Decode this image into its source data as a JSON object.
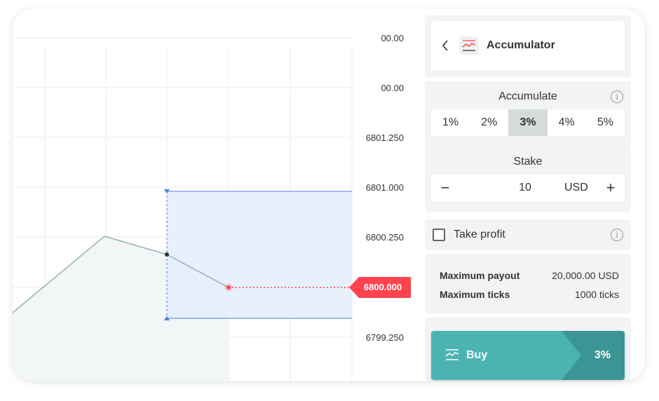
{
  "chart": {
    "price_labels": [
      "00.00",
      "00.00",
      "6801.250",
      "6801.000",
      "6800.250",
      "6800.000",
      "6799.250"
    ],
    "current_price": "6800.000",
    "line_color": "#8fb6b4",
    "barrier_color": "#4a7fe0",
    "current_color": "#ff444f"
  },
  "header": {
    "title": "Accumulator",
    "back_icon": "chevron-left-icon",
    "trade_icon": "accumulator-icon"
  },
  "accumulate": {
    "title": "Accumulate",
    "info_icon": "info-icon",
    "options": [
      "1%",
      "2%",
      "3%",
      "4%",
      "5%"
    ],
    "selected": "3%"
  },
  "stake": {
    "title": "Stake",
    "minus": "−",
    "plus": "+",
    "value": "10",
    "currency": "USD"
  },
  "take_profit": {
    "label": "Take profit",
    "checked": false
  },
  "payout": {
    "max_payout_label": "Maximum payout",
    "max_payout_value": "20,000.00 USD",
    "max_ticks_label": "Maximum ticks",
    "max_ticks_value": "1000 ticks"
  },
  "buy": {
    "label": "Buy",
    "percent": "3%",
    "color": "#4bb4b3",
    "dark_color": "#3d9494"
  }
}
